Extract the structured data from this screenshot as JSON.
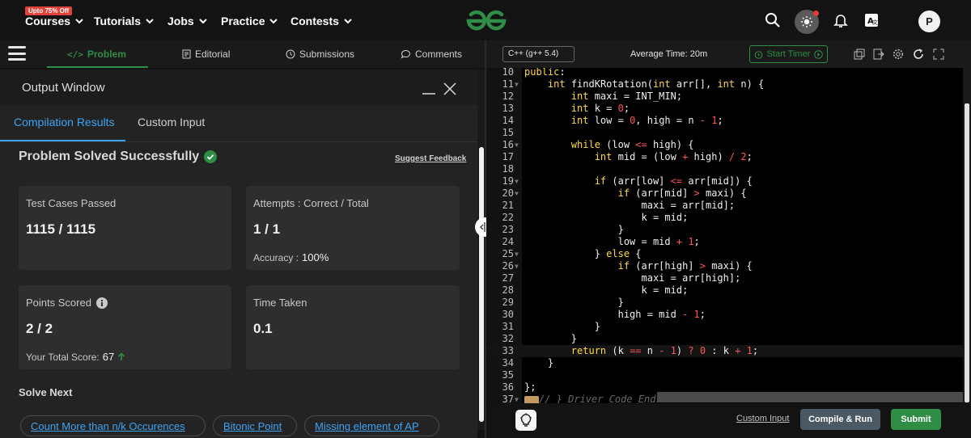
{
  "topnav": {
    "promo": "Upto 75% Off",
    "items": [
      "Courses",
      "Tutorials",
      "Jobs",
      "Practice",
      "Contests"
    ],
    "avatar_letter": "P",
    "colors": {
      "brand": "#2f8d46",
      "notify": "#e53935"
    }
  },
  "left_tabs": [
    "Problem",
    "Editorial",
    "Submissions",
    "Comments"
  ],
  "output": {
    "title": "Output Window",
    "tabs": [
      "Compilation Results",
      "Custom Input"
    ],
    "status": "Problem Solved Successfully",
    "suggest": "Suggest Feedback",
    "cards": {
      "tests_label": "Test Cases Passed",
      "tests_value": "1115 / 1115",
      "attempts_label": "Attempts : Correct / Total",
      "attempts_value": "1 / 1",
      "accuracy_label": "Accuracy :",
      "accuracy_value": "100%",
      "points_label": "Points Scored",
      "points_value": "2 / 2",
      "total_label": "Your Total Score:",
      "total_value": "67",
      "time_label": "Time Taken",
      "time_value": "0.1"
    },
    "solve_next": "Solve Next",
    "suggestions": [
      "Count More than n/k Occurences",
      "Bitonic Point",
      "Missing element of AP"
    ]
  },
  "editor": {
    "language": "C++ (g++ 5.4)",
    "avg_time": "Average Time: 20m",
    "timer": "Start Timer",
    "custom_input": "Custom Input",
    "compile": "Compile & Run",
    "submit": "Submit",
    "highlighted_line": 33,
    "lines": [
      {
        "n": "10",
        "fold": false,
        "html": "<span class=\"kw\">public</span>:"
      },
      {
        "n": "11",
        "fold": true,
        "html": "    <span class=\"kw\">int</span> findKRotation(<span class=\"kw\">int</span> arr[], <span class=\"kw\">int</span> n) {"
      },
      {
        "n": "12",
        "fold": false,
        "html": "        <span class=\"kw\">int</span> maxi = INT_MIN;"
      },
      {
        "n": "13",
        "fold": false,
        "html": "        <span class=\"kw\">int</span> k = <span class=\"num\">0</span>;"
      },
      {
        "n": "14",
        "fold": false,
        "html": "        <span class=\"kw\">int</span> low = <span class=\"num\">0</span>, high = n <span class=\"num\">-</span> <span class=\"num\">1</span>;"
      },
      {
        "n": "15",
        "fold": false,
        "html": ""
      },
      {
        "n": "16",
        "fold": true,
        "html": "        <span class=\"kw\">while</span> (low <span class=\"num\">&lt;=</span> high) {"
      },
      {
        "n": "17",
        "fold": false,
        "html": "            <span class=\"kw\">int</span> mid = (low <span class=\"num\">+</span> high) <span class=\"num\">/</span> <span class=\"num\">2</span>;"
      },
      {
        "n": "18",
        "fold": false,
        "html": ""
      },
      {
        "n": "19",
        "fold": true,
        "html": "            <span class=\"kw\">if</span> (arr[low] <span class=\"num\">&lt;=</span> arr[mid]) {"
      },
      {
        "n": "20",
        "fold": true,
        "html": "                <span class=\"kw\">if</span> (arr[mid] <span class=\"num\">&gt;</span> maxi) {"
      },
      {
        "n": "21",
        "fold": false,
        "html": "                    maxi = arr[mid];"
      },
      {
        "n": "22",
        "fold": false,
        "html": "                    k = mid;"
      },
      {
        "n": "23",
        "fold": false,
        "html": "                }"
      },
      {
        "n": "24",
        "fold": false,
        "html": "                low = mid <span class=\"num\">+</span> <span class=\"num\">1</span>;"
      },
      {
        "n": "25",
        "fold": true,
        "html": "            } <span class=\"kw\">else</span> {"
      },
      {
        "n": "26",
        "fold": true,
        "html": "                <span class=\"kw\">if</span> (arr[high] <span class=\"num\">&gt;</span> maxi) {"
      },
      {
        "n": "27",
        "fold": false,
        "html": "                    maxi = arr[high];"
      },
      {
        "n": "28",
        "fold": false,
        "html": "                    k = mid;"
      },
      {
        "n": "29",
        "fold": false,
        "html": "                }"
      },
      {
        "n": "30",
        "fold": false,
        "html": "                high = mid <span class=\"num\">-</span> <span class=\"num\">1</span>;"
      },
      {
        "n": "31",
        "fold": false,
        "html": "            }"
      },
      {
        "n": "32",
        "fold": false,
        "html": "        }"
      },
      {
        "n": "33",
        "fold": false,
        "html": "        <span class=\"kw\">return</span> (k <span class=\"num\">==</span> n <span class=\"num\">-</span> <span class=\"num\">1</span>) <span class=\"num\">?</span> <span class=\"num\">0</span> : k <span class=\"num\">+</span> <span class=\"num\">1</span>;"
      },
      {
        "n": "34",
        "fold": false,
        "html": "    }"
      },
      {
        "n": "35",
        "fold": false,
        "html": ""
      },
      {
        "n": "36",
        "fold": false,
        "html": "};"
      },
      {
        "n": "37",
        "fold": true,
        "html": "<span class=\"fnpill\"></span><span class=\"cm\">// } Driver Code Ends</span>"
      }
    ]
  }
}
